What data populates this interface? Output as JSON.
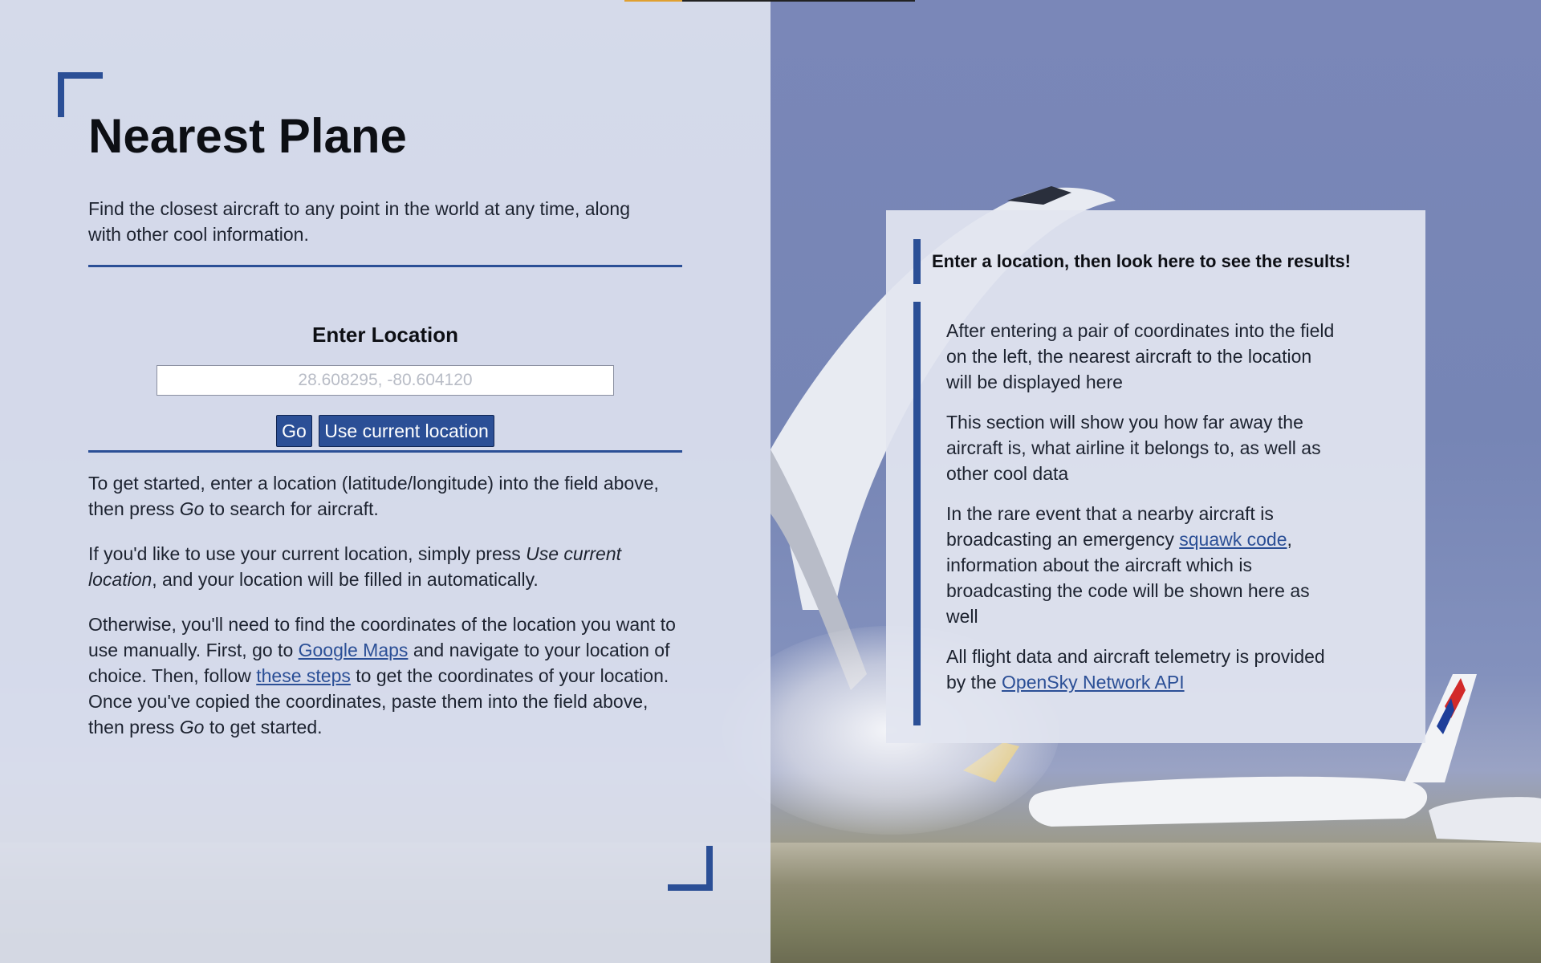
{
  "page": {
    "title": "Nearest Plane",
    "intro": "Find the closest aircraft to any point in the world at any time, along with other cool information."
  },
  "form": {
    "heading": "Enter Location",
    "input_placeholder": "28.608295, -80.604120",
    "go_label": "Go",
    "use_current_label": "Use current location"
  },
  "instructions": {
    "p1_a": "To get started, enter a location (latitude/longitude) into the field above, then press ",
    "p1_em": "Go",
    "p1_b": " to search for aircraft.",
    "p2_a": "If you'd like to use your current location, simply press ",
    "p2_em": "Use current location",
    "p2_b": ", and your location will be filled in automatically.",
    "p3_a": "Otherwise, you'll need to find the coordinates of the location you want to use manually. First, go to ",
    "p3_link1": "Google Maps",
    "p3_b": " and navigate to your location of choice. Then, follow ",
    "p3_link2": "these steps",
    "p3_c": " to get the coordinates of your location. Once you've copied the coordinates, paste them into the field above, then press ",
    "p3_em": "Go",
    "p3_d": " to get started."
  },
  "results": {
    "heading": "Enter a location, then look here to see the results!",
    "p1": "After entering a pair of coordinates into the field on the left, the nearest aircraft to the location will be displayed here",
    "p2": "This section will show you how far away the aircraft is, what airline it belongs to, as well as other cool data",
    "p3_a": "In the rare event that a nearby aircraft is broadcasting an emergency ",
    "p3_link": "squawk code",
    "p3_b": ", information about the aircraft which is broadcasting the code will be shown here as well",
    "p4_a": "All flight data and aircraft telemetry is provided by the ",
    "p4_link": "OpenSky Network API"
  },
  "colors": {
    "accent": "#2b4f96",
    "left_panel_bg": "#dce0ee",
    "text": "#1d2330"
  }
}
